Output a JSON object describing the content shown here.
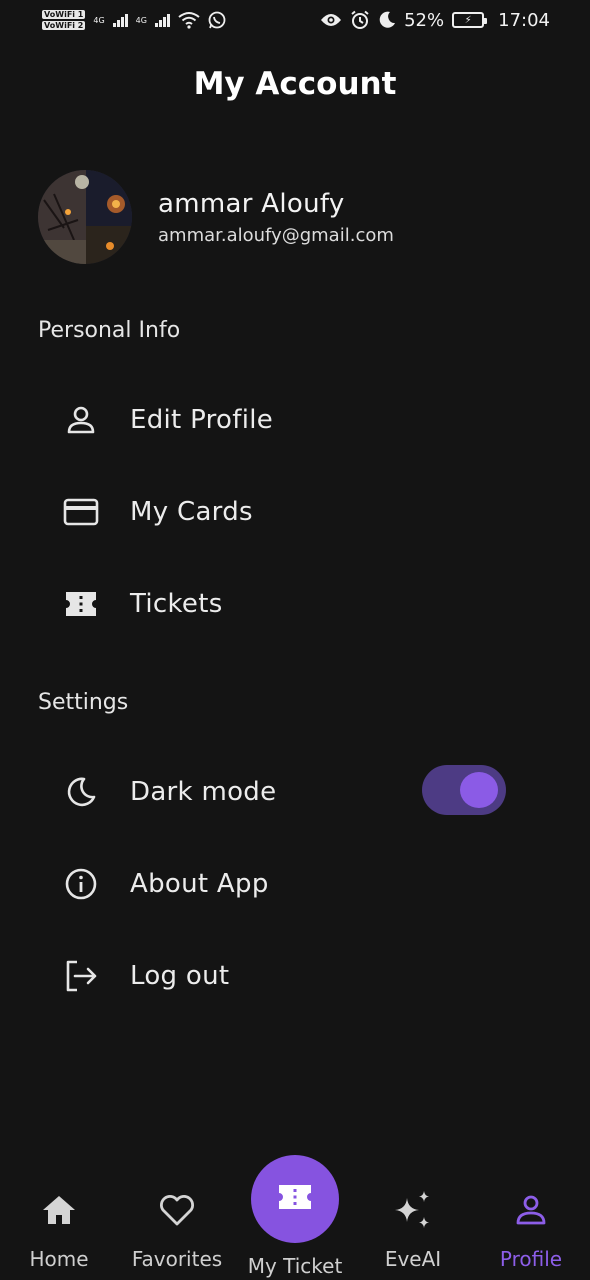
{
  "status_bar": {
    "sim1": "VoWiFi 1",
    "sim2": "VoWiFi 2",
    "net1": "4G",
    "net2": "4G",
    "battery_percent": "52%",
    "time": "17:04"
  },
  "header": {
    "title": "My Account"
  },
  "profile": {
    "name": "ammar Aloufy",
    "email": "ammar.aloufy@gmail.com"
  },
  "sections": {
    "personal_info": "Personal Info",
    "settings": "Settings"
  },
  "personal_items": [
    {
      "label": "Edit Profile",
      "icon": "person-icon"
    },
    {
      "label": "My Cards",
      "icon": "card-icon"
    },
    {
      "label": "Tickets",
      "icon": "ticket-icon"
    }
  ],
  "settings_items": [
    {
      "label": "Dark mode",
      "icon": "moon-icon",
      "toggle_on": true
    },
    {
      "label": "About App",
      "icon": "info-icon"
    },
    {
      "label": "Log out",
      "icon": "logout-icon"
    }
  ],
  "bottom_nav": [
    {
      "label": "Home",
      "icon": "home-icon"
    },
    {
      "label": "Favorites",
      "icon": "heart-icon"
    },
    {
      "label": "My Ticket",
      "icon": "ticket-icon"
    },
    {
      "label": "EveAI",
      "icon": "sparkle-icon"
    },
    {
      "label": "Profile",
      "icon": "person-icon",
      "active": true
    }
  ],
  "colors": {
    "background": "#141414",
    "accent": "#8653e0",
    "toggle_track": "#4d3b84"
  }
}
